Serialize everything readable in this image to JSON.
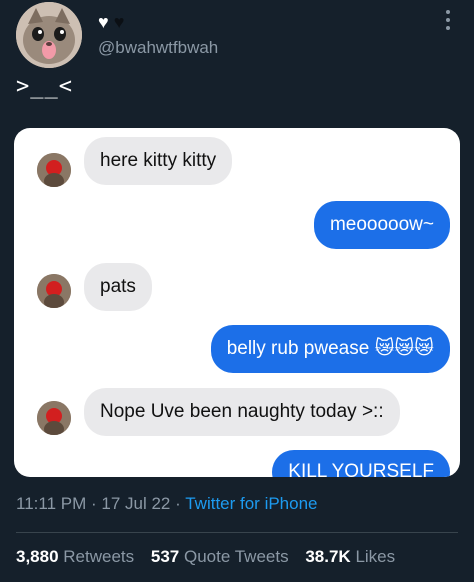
{
  "profile": {
    "hearts": [
      "♥",
      "♥"
    ],
    "handle": "@bwahwtfbwah",
    "more_icon": "more-vertical-icon"
  },
  "tweet": {
    "text": ">__<"
  },
  "chat": {
    "messages": [
      {
        "side": "in",
        "text": "here kitty kitty"
      },
      {
        "side": "out",
        "text": "meooooow~"
      },
      {
        "side": "in",
        "text": "pats"
      },
      {
        "side": "out",
        "text": "belly rub pwease 😿😿😿"
      },
      {
        "side": "in",
        "text": "Nope Uve been naughty today >::"
      },
      {
        "side": "out",
        "text": "KILL YOURSELF"
      }
    ],
    "colors": {
      "incoming": "#e9e9eb",
      "outgoing": "#1c6fe8"
    }
  },
  "meta": {
    "time": "11:11 PM",
    "separator": "·",
    "date": "17 Jul 22",
    "source": "Twitter for iPhone"
  },
  "stats": {
    "retweets_count": "3,880",
    "retweets_label": "Retweets",
    "quotes_count": "537",
    "quotes_label": "Quote Tweets",
    "likes_count": "38.7K",
    "likes_label": "Likes"
  }
}
